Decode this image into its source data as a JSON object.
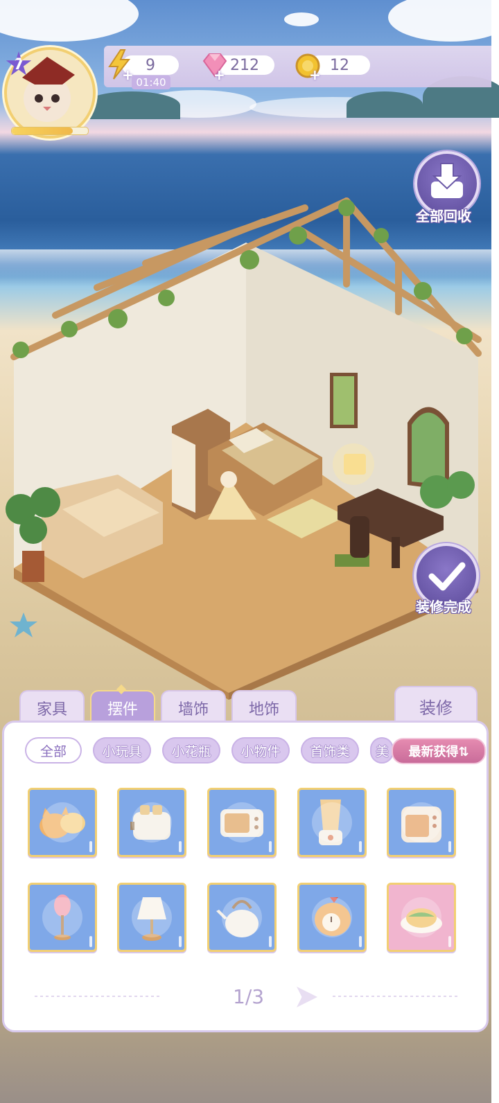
{
  "hud": {
    "level": "7",
    "level_progress": 0.8,
    "energy": "9",
    "energy_timer": "01:40",
    "gems": "212",
    "coins": "12"
  },
  "side_buttons": {
    "collect_all": "全部回收",
    "finish_decor": "装修完成"
  },
  "tabs": [
    "家具",
    "摆件",
    "墙饰",
    "地饰"
  ],
  "active_tab": "摆件",
  "renovate_tab": "装修",
  "categories": [
    "全部",
    "小玩具",
    "小花瓶",
    "小物件",
    "首饰类",
    "美"
  ],
  "active_category": "全部",
  "newest_button": "最新获得⇅",
  "items_row1": [
    "cat-cushion-icon",
    "toaster-icon",
    "microwave-icon",
    "blender-icon",
    "oven-icon"
  ],
  "items_row2": [
    "lotus-lamp-icon",
    "table-lamp-icon",
    "teapot-icon",
    "chicken-clock-icon",
    "cat-taco-plate-icon"
  ],
  "pager": "1/3",
  "colors": {
    "panel_border": "#d8c9ec",
    "item_bg": "#7fa8e8",
    "item_frame": "#f2cf72",
    "tab_active": "#b8a0dc",
    "newest_btn": "#d77ba6"
  }
}
